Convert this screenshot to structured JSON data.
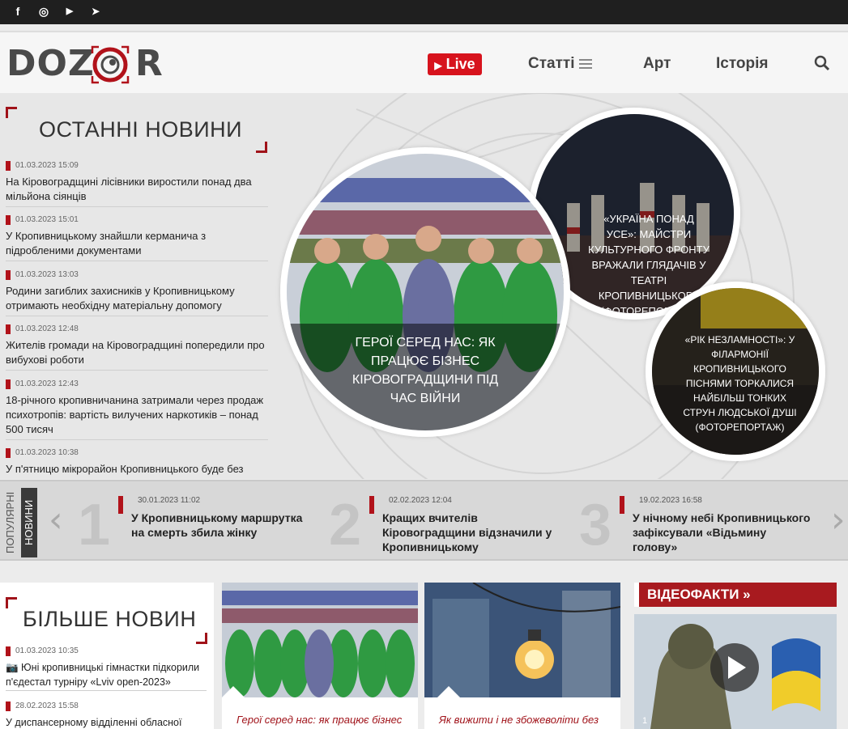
{
  "social": {
    "facebook": "f",
    "instagram": "◎",
    "youtube": "▶",
    "telegram": "➤"
  },
  "header": {
    "logo_left": "DOZ",
    "logo_right": "R",
    "live_label": "Live",
    "nav": [
      "Статті",
      "Арт",
      "Історія"
    ]
  },
  "latest": {
    "title": "ОСТАННІ НОВИНИ",
    "items": [
      {
        "date": "01.03.2023 15:09",
        "title": "На Кіровоградщині лісівники виростили понад два мільйона сіянців"
      },
      {
        "date": "01.03.2023 15:01",
        "title": "У Кропивницькому знайшли керманича з підробленими документами"
      },
      {
        "date": "01.03.2023 13:03",
        "title": "Родини загиблих захисників у Кропивницькому отримають необхідну матеріальну допомогу"
      },
      {
        "date": "01.03.2023 12:48",
        "title": "Жителів громади на Кіровоградщині попередили про вибухові роботи"
      },
      {
        "date": "01.03.2023 12:43",
        "title": "18-річного кропивничанина затримали через продаж психотропів: вартість вилучених наркотиків – понад 500 тисяч"
      },
      {
        "date": "01.03.2023 10:38",
        "title": "У п'ятницю мікрорайон Кропивницького буде без води"
      }
    ]
  },
  "featured": {
    "main": "ГЕРОЇ СЕРЕД НАС: ЯК ПРАЦЮЄ БІЗНЕС КІРОВОГРАДЩИНИ ПІД ЧАС ВІЙНИ",
    "top_right": "«УКРАЇНА ПОНАД УСЕ»: МАЙСТРИ КУЛЬТУРНОГО ФРОНТУ ВРАЖАЛИ ГЛЯДАЧІВ У ТЕАТРІ КРОПИВНИЦЬКОГО (ФОТОРЕПОРТАЖ)",
    "bottom_right": "«РІК НЕЗЛАМНОСТІ»: У ФІЛАРМОНІЇ КРОПИВНИЦЬКОГО ПІСНЯМИ ТОРКАЛИСЯ НАЙБІЛЬШ ТОНКИХ СТРУН ЛЮДСЬКОЇ ДУШІ (ФОТОРЕПОРТАЖ)"
  },
  "popular": {
    "label_top": "ПОПУЛЯРНІ",
    "label_bottom": "НОВИНИ",
    "items": [
      {
        "num": "1",
        "date": "30.01.2023 11:02",
        "title": "У Кропивницькому маршрутка на смерть збила жінку"
      },
      {
        "num": "2",
        "date": "02.02.2023 12:04",
        "title": "Кращих вчителів Кіровоградщини відзначили у Кропивницькому"
      },
      {
        "num": "3",
        "date": "19.02.2023 16:58",
        "title": "У нічному небі Кропивницького зафіксували «Відьмину голову»"
      }
    ]
  },
  "more": {
    "title": "БІЛЬШЕ НОВИН",
    "items": [
      {
        "date": "01.03.2023 10:35",
        "title": "📷 Юні кропивницькі гімнастки підкорили п'єдестал турніру «Lviv open-2023»"
      },
      {
        "date": "28.02.2023 15:58",
        "title": "У диспансерному відділенні обласної"
      }
    ]
  },
  "cards": [
    {
      "title": "Герої серед нас: як працює бізнес"
    },
    {
      "title": "Як вижити і не збожеволіти без"
    }
  ],
  "video": {
    "title": "ВІДЕОФАКТИ »",
    "counter": "1"
  }
}
